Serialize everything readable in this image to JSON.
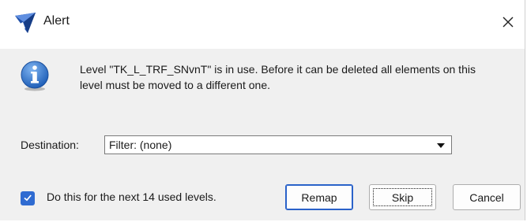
{
  "window": {
    "title": "Alert",
    "icon": "app-logo-icon",
    "close_icon": "close-icon"
  },
  "message": {
    "icon": "info-icon",
    "text": "Level \"TK_L_TRF_SNvnT\" is in use.  Before it can be deleted all elements on this level must be moved to a different one."
  },
  "destination": {
    "label": "Destination:",
    "selected": "Filter: (none)"
  },
  "apply_all": {
    "checked": true,
    "label": "Do this for the next 14 used levels."
  },
  "buttons": {
    "remap": "Remap",
    "skip": "Skip",
    "cancel": "Cancel"
  },
  "colors": {
    "accent": "#2f6bd1",
    "body_background": "#f0f0f0",
    "titlebar_background": "#ffffff"
  }
}
